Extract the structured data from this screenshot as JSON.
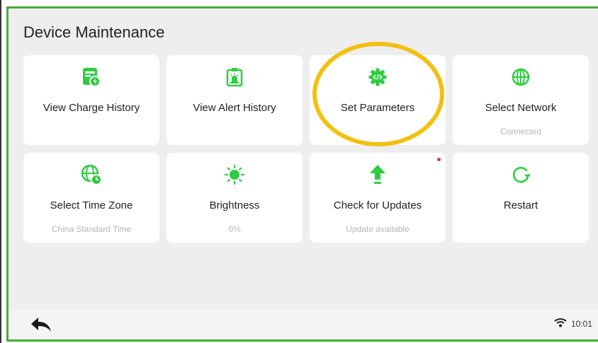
{
  "page": {
    "title": "Device Maintenance"
  },
  "accent_color": "#2ecc40",
  "annotation_color": "#f2c011",
  "cards": [
    {
      "label": "View Charge History",
      "sub": "",
      "icon": "charge-history-icon"
    },
    {
      "label": "View Alert History",
      "sub": "",
      "icon": "alert-history-icon"
    },
    {
      "label": "Set Parameters",
      "sub": "",
      "icon": "settings-gear-icon"
    },
    {
      "label": "Select Network",
      "sub": "Connected",
      "icon": "globe-network-icon"
    },
    {
      "label": "Select Time Zone",
      "sub": "China Standard Time",
      "icon": "timezone-globe-clock-icon"
    },
    {
      "label": "Brightness",
      "sub": "0%",
      "icon": "sun-brightness-icon"
    },
    {
      "label": "Check for Updates",
      "sub": "Update available",
      "icon": "upload-arrow-icon",
      "badge_color": "#e53935"
    },
    {
      "label": "Restart",
      "sub": "",
      "icon": "restart-icon"
    }
  ],
  "status_bar": {
    "time": "10:01",
    "wifi_icon": "wifi-icon",
    "back_icon": "back-arrow-icon"
  }
}
